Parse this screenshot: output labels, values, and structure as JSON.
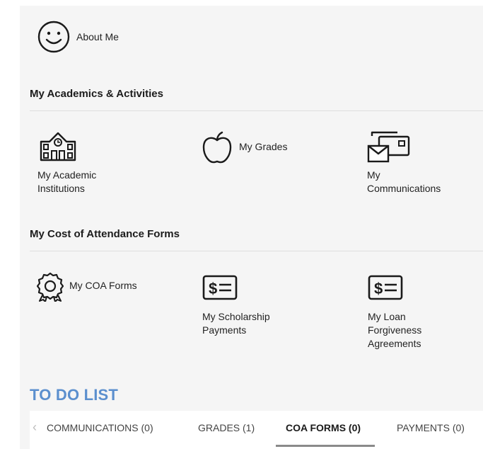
{
  "profile": {
    "about_me_label": "About Me"
  },
  "sections": {
    "academics_title": "My Academics & Activities",
    "coa_title": "My Cost of Attendance Forms"
  },
  "academics": {
    "institutions_label": "My Academic Institutions",
    "grades_label": "My Grades",
    "communications_label": "My Communications"
  },
  "coa": {
    "forms_label": "My COA Forms",
    "scholarship_label": "My Scholarship Payments",
    "loan_label": "My Loan Forgiveness Agreements"
  },
  "todo": {
    "title": "TO DO LIST",
    "tabs": [
      {
        "label": "COMMUNICATIONS (0)",
        "active": false
      },
      {
        "label": "GRADES (1)",
        "active": false
      },
      {
        "label": "COA FORMS (0)",
        "active": true
      },
      {
        "label": "PAYMENTS (0)",
        "active": false
      }
    ]
  },
  "icons": {
    "about_me": "smiley-face-icon",
    "institutions": "school-building-icon",
    "grades": "apple-icon",
    "communications": "mail-messages-icon",
    "coa_forms": "award-ribbon-icon",
    "scholarship": "dollar-bill-icon",
    "loan": "dollar-bill-icon",
    "scroll_left": "chevron-left-icon"
  },
  "colors": {
    "accent": "#5b8fce",
    "panel_background": "#f5f5f5",
    "tab_underline": "#8a8a8a"
  }
}
